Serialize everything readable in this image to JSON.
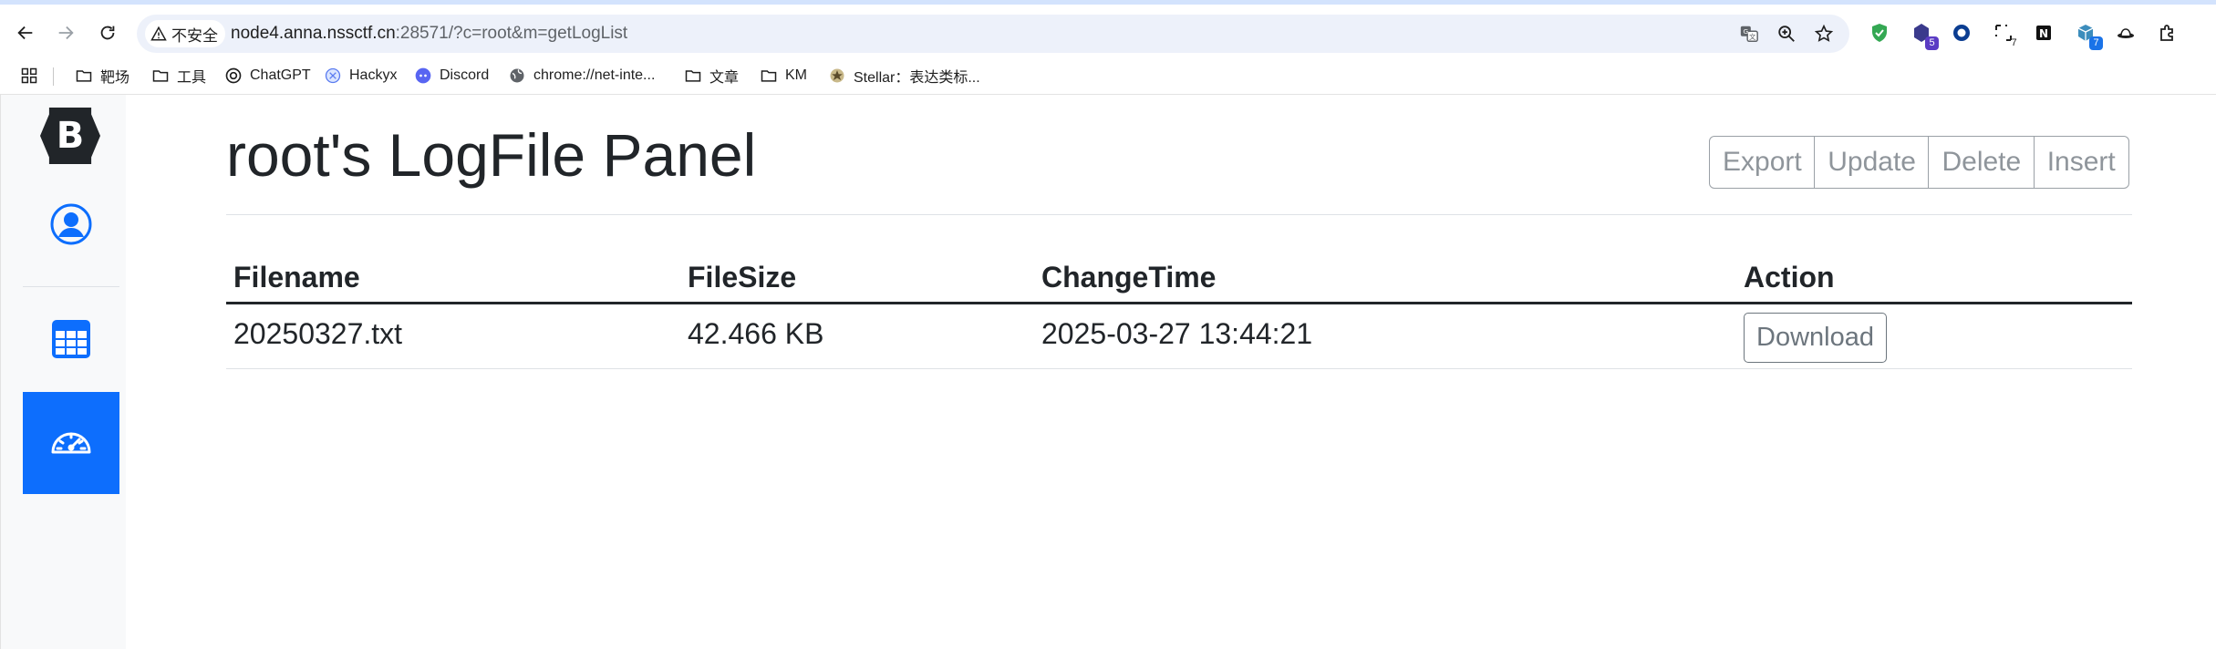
{
  "browser": {
    "security_label": "不安全",
    "url_host": "node4.anna.nssctf.cn",
    "url_rest": ":28571/?c=root&m=getLogList",
    "extensions": [
      {
        "icon": "shield-check-icon",
        "badge": ""
      },
      {
        "icon": "hexagon-extension-icon",
        "badge": "5"
      },
      {
        "icon": "ring-extension-icon",
        "badge": ""
      },
      {
        "icon": "dashed-extension-icon",
        "badge": "7"
      },
      {
        "icon": "notion-icon",
        "badge": ""
      },
      {
        "icon": "cube-extension-icon",
        "badge": "7"
      },
      {
        "icon": "hat-extension-icon",
        "badge": ""
      },
      {
        "icon": "puzzle-icon",
        "badge": ""
      }
    ],
    "colors": {
      "badge_purple": "#5b3cc4",
      "badge_blue": "#1a73e8",
      "shield_green": "#34a853"
    }
  },
  "bookmarks": [
    {
      "icon": "folder-icon",
      "label": "靶场"
    },
    {
      "icon": "folder-icon",
      "label": "工具"
    },
    {
      "icon": "chatgpt-icon",
      "label": "ChatGPT"
    },
    {
      "icon": "hackyx-icon",
      "label": "Hackyx"
    },
    {
      "icon": "discord-icon",
      "label": "Discord"
    },
    {
      "icon": "globe-icon",
      "label": "chrome://net-inte..."
    },
    {
      "icon": "folder-icon",
      "label": "文章"
    },
    {
      "icon": "folder-icon",
      "label": "KM"
    },
    {
      "icon": "stellar-icon",
      "label": "Stellar：表达类标..."
    }
  ],
  "sidebar": {
    "brand": "B",
    "items": [
      {
        "icon": "person-circle-icon",
        "active": false
      },
      {
        "icon": "table-icon",
        "active": false
      },
      {
        "icon": "speedometer-icon",
        "active": true
      }
    ],
    "colors": {
      "accent": "#0d6efd",
      "brand_bg": "#212529"
    }
  },
  "main": {
    "title": "root's LogFile Panel",
    "actions": [
      "Export",
      "Update",
      "Delete",
      "Insert"
    ],
    "table": {
      "headers": [
        "Filename",
        "FileSize",
        "ChangeTime",
        "Action"
      ],
      "rows": [
        {
          "filename": "20250327.txt",
          "filesize": "42.466 KB",
          "changetime": "2025-03-27 13:44:21",
          "action": "Download"
        }
      ]
    }
  }
}
